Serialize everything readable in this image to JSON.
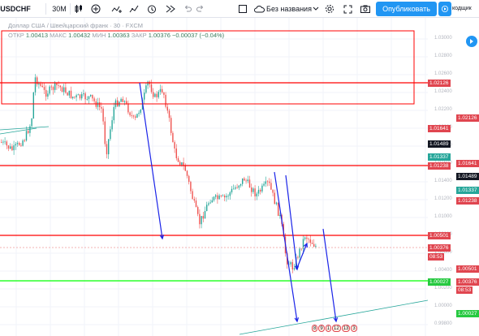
{
  "toolbar": {
    "symbol": "USDCHF",
    "interval": "30M",
    "layout_name": "Без названия",
    "publish_label": "Опубликовать",
    "side_label": "кодщик",
    "icons": [
      "crosshair-icon",
      "candles-icon",
      "add-icon",
      "indicators-icon",
      "alert-icon",
      "replay-icon",
      "undo-icon",
      "redo-icon",
      "square-icon",
      "cloud-icon",
      "settings-icon",
      "fullscreen-icon",
      "camera-icon",
      "play-icon"
    ]
  },
  "legend": {
    "title": "Доллар США / Швейцарский франк · 30 · FXCM",
    "open_label": "ОТКР",
    "open": "1.00413",
    "high_label": "МАКС",
    "high": "1.00432",
    "low_label": "МИН",
    "low": "1.00363",
    "close_label": "ЗАКР",
    "close": "1.00376",
    "change": "−0.00037 (−0.04%)"
  },
  "price_ticks": [
    "1.03000",
    "1.02800",
    "1.02600",
    "1.02400",
    "1.02200",
    "1.02000",
    "1.01800",
    "1.01600",
    "1.01400",
    "1.01200",
    "1.01000",
    "1.00800",
    "1.00600",
    "1.00400",
    "1.00200",
    "1.00000",
    "0.99800"
  ],
  "price_labels": [
    {
      "text": "1.02126",
      "color": "#e0454f"
    },
    {
      "text": "1.02126",
      "color": "#e0454f"
    },
    {
      "text": "1.01641",
      "color": "#e0454f"
    },
    {
      "text": "1.01489",
      "color": "#131722"
    },
    {
      "text": "1.01337",
      "color": "#26a69a"
    },
    {
      "text": "1.01641",
      "color": "#e0454f"
    },
    {
      "text": "1.01238",
      "color": "#e0454f"
    },
    {
      "text": "1.01489",
      "color": "#131722"
    },
    {
      "text": "1.01337",
      "color": "#26a69a"
    },
    {
      "text": "1.01238",
      "color": "#e0454f"
    },
    {
      "text": "1.00501",
      "color": "#e0454f"
    },
    {
      "text": "1.00376",
      "color": "#e0454f"
    },
    {
      "text": "08:53",
      "color": "#e0454f"
    },
    {
      "text": "1.00501",
      "color": "#e0454f"
    },
    {
      "text": "1.00027",
      "color": "#26c940"
    },
    {
      "text": "1.00376",
      "color": "#e0454f"
    },
    {
      "text": "08:53",
      "color": "#e0454f"
    },
    {
      "text": "1.00027",
      "color": "#26c940"
    }
  ],
  "time_badges": [
    "8",
    "9",
    "1",
    "12",
    "13",
    "3"
  ],
  "colors": {
    "up": "#26a69a",
    "down": "#ef5350",
    "level_line": "#ff0000",
    "support_line": "#00ff00",
    "arrow": "#1a23e8",
    "accent": "#2196f3"
  }
}
